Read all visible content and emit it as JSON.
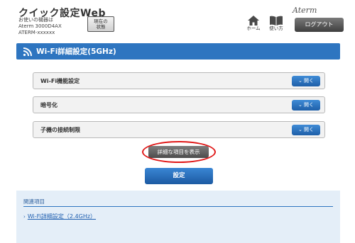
{
  "header": {
    "app_title": "クイック設定Web",
    "device_line1": "お使いの機器は",
    "device_line2": "Aterm 3000D4AX",
    "device_line3": "ATERM-xxxxxx",
    "status_line1": "現在の",
    "status_line2": "状態",
    "home_label": "ホーム",
    "manual_label": "使い方",
    "logo": "Aterm",
    "logout_label": "ログアウト"
  },
  "section": {
    "title": "Wi-Fi詳細設定(5GHz)"
  },
  "accordion": [
    {
      "label": "Wi-Fi機能設定",
      "button": "開く"
    },
    {
      "label": "暗号化",
      "button": "開く"
    },
    {
      "label": "子機の接続制限",
      "button": "開く"
    }
  ],
  "detail_button": "詳細な項目を表示",
  "submit_button": "設定",
  "related": {
    "title": "関連項目",
    "link": "Wi-Fi詳細設定（2.4GHz）"
  },
  "colors": {
    "accent": "#2e75c0",
    "highlight_ring": "#e01818"
  }
}
